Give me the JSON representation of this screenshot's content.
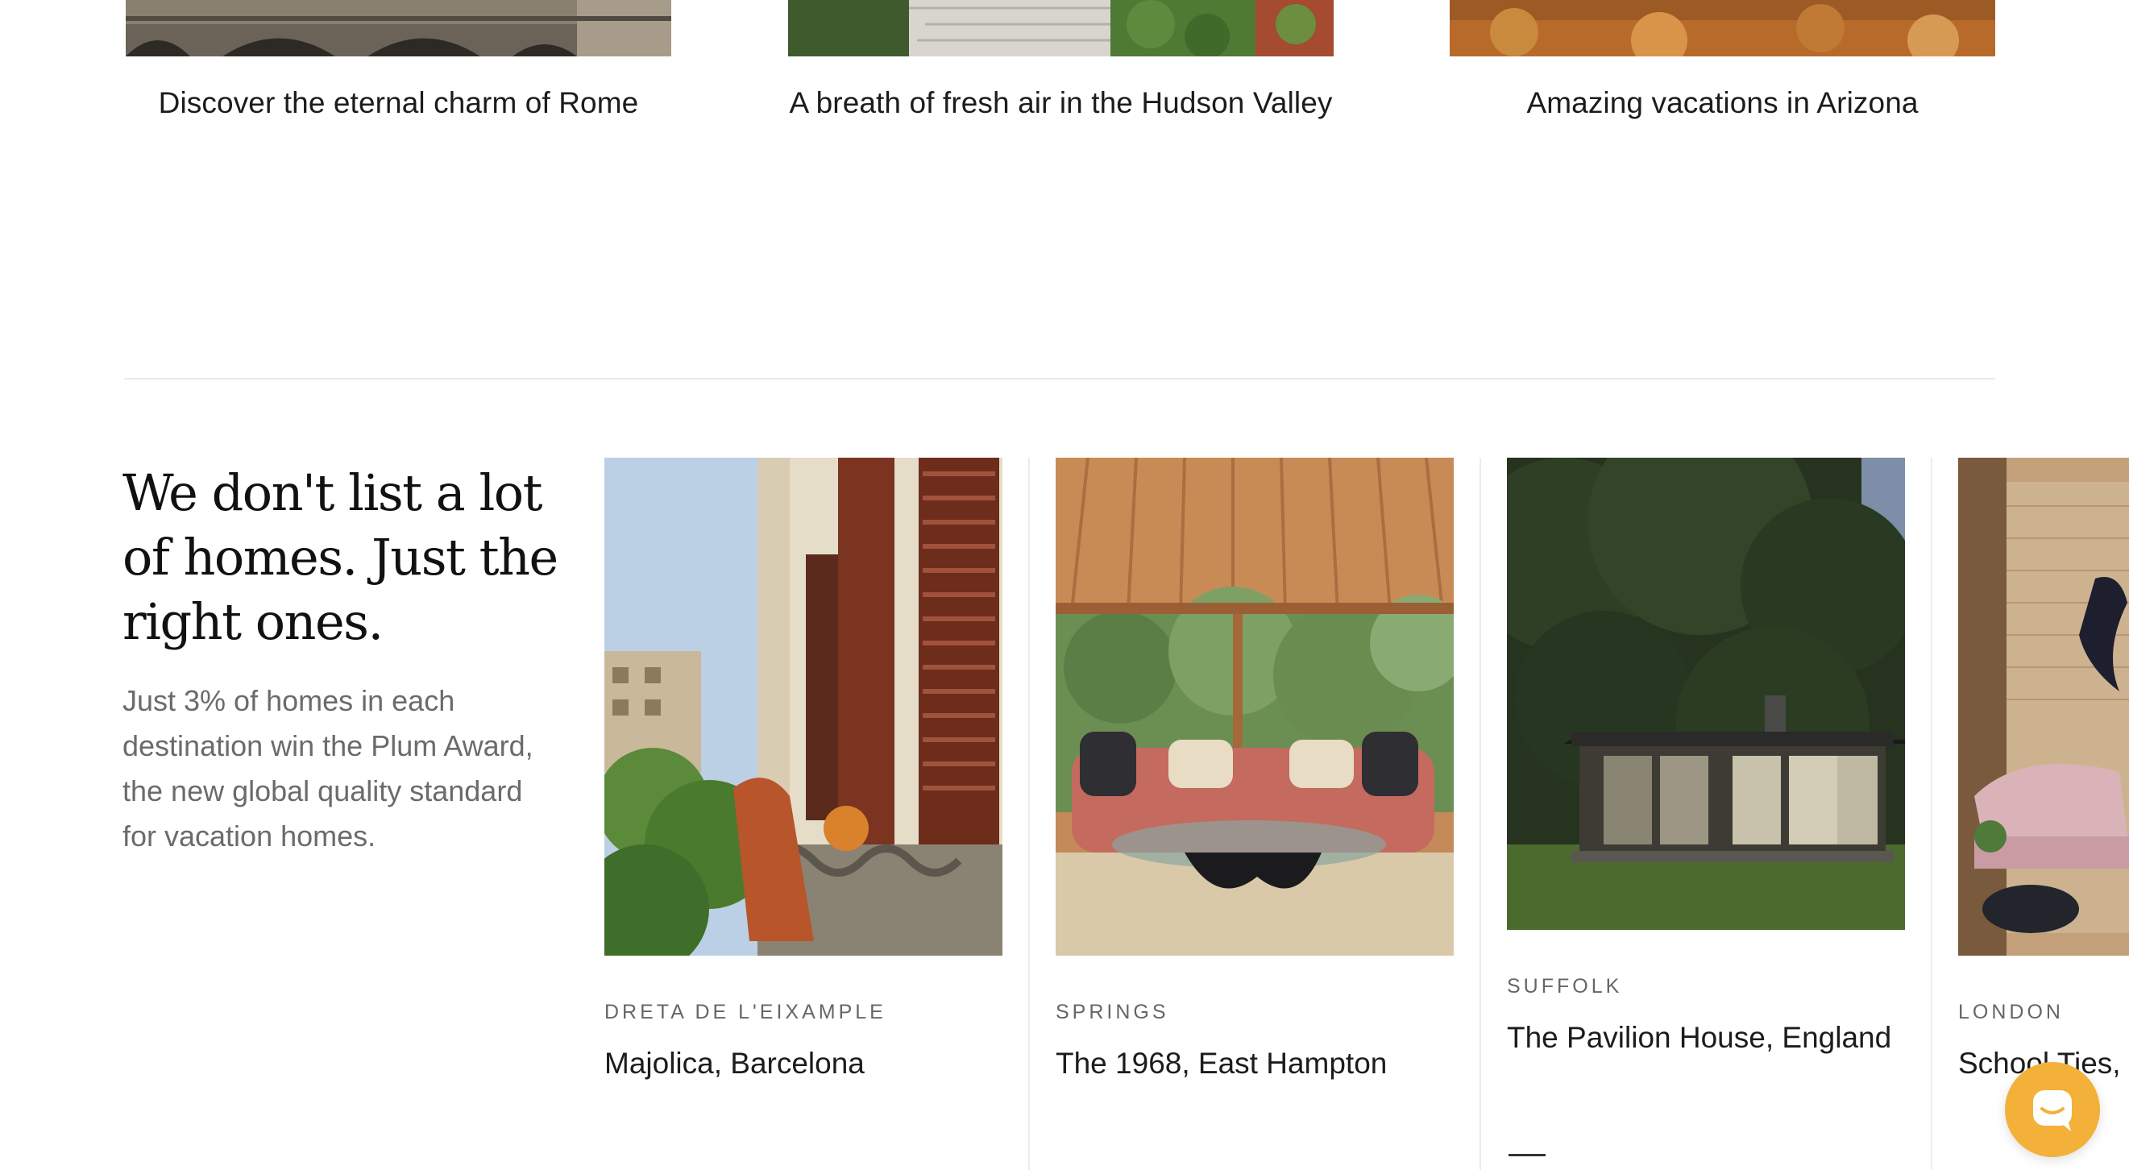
{
  "destinations": [
    {
      "title": "Discover the eternal charm of Rome",
      "image": "rome-bridge-photo"
    },
    {
      "title": "A breath of fresh air in the Hudson Valley",
      "image": "hudson-valley-garden-photo"
    },
    {
      "title": "Amazing vacations in Arizona",
      "image": "arizona-desert-photo"
    }
  ],
  "intro": {
    "heading": "We don't list a lot of homes. Just the right ones.",
    "body": "Just 3% of homes in each destination win the Plum Award, the new global quality standard for vacation homes."
  },
  "homes": [
    {
      "region": "DRETA DE L'EIXAMPLE",
      "name": "Majolica, Barcelona",
      "image": "barcelona-balcony-photo"
    },
    {
      "region": "SPRINGS",
      "name": "The 1968, East Hampton",
      "image": "east-hampton-living-room-photo"
    },
    {
      "region": "SUFFOLK",
      "name": "The Pavilion House, England",
      "image": "suffolk-pavilion-house-photo"
    },
    {
      "region": "LONDON",
      "name": "School Ties,",
      "image": "london-loft-photo"
    }
  ],
  "chat": {
    "icon": "chat-bubble-icon",
    "color": "#f3b13a"
  },
  "colors": {
    "text": "#1c1c1c",
    "muted": "#6b6b6b",
    "divider": "#e9e9e9",
    "accent": "#f3b13a"
  }
}
